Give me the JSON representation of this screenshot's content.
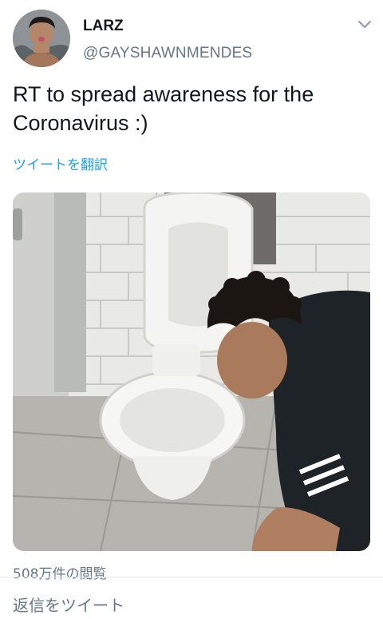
{
  "tweet": {
    "author_name": "LARZ",
    "author_handle": "@GAYSHAWNMENDES",
    "text": "RT to spread awareness for the\nCoronavirus :)",
    "translate_label": "ツイートを翻訳",
    "view_count": "508万件の閲覧"
  },
  "reply": {
    "placeholder": "返信をツイート"
  },
  "icons": {
    "menu": "chevron-down-icon"
  },
  "colors": {
    "link": "#1da1f2",
    "secondary_text": "#657786",
    "primary_text": "#14171a"
  }
}
